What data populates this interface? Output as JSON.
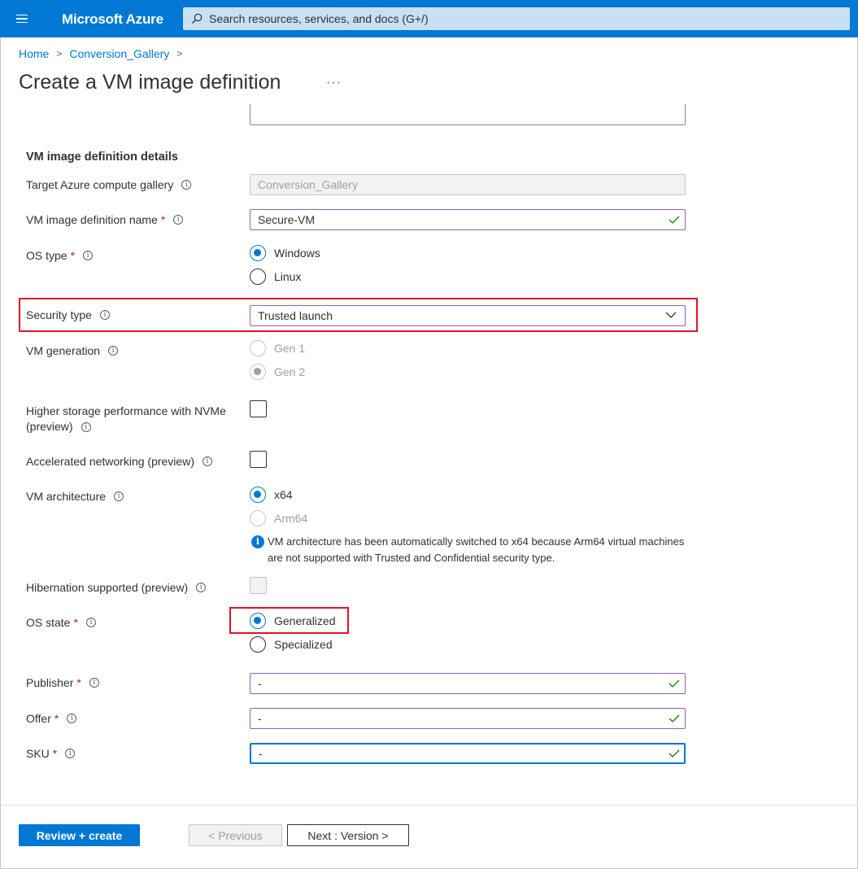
{
  "topbar": {
    "brand": "Microsoft Azure",
    "search_placeholder": "Search resources, services, and docs (G+/)"
  },
  "breadcrumb": {
    "items": [
      "Home",
      "Conversion_Gallery"
    ]
  },
  "page": {
    "title": "Create a VM image definition",
    "more": "···"
  },
  "form": {
    "section_title": "VM image definition details",
    "target_gallery": {
      "label": "Target Azure compute gallery",
      "value": "Conversion_Gallery"
    },
    "definition_name": {
      "label": "VM image definition name",
      "value": "Secure-VM"
    },
    "os_type": {
      "label": "OS type",
      "options": [
        "Windows",
        "Linux"
      ],
      "selected": "Windows"
    },
    "security_type": {
      "label": "Security type",
      "value": "Trusted launch"
    },
    "vm_generation": {
      "label": "VM generation",
      "options": [
        "Gen 1",
        "Gen 2"
      ],
      "selected": "Gen 2"
    },
    "nvme": {
      "label_line1": "Higher storage performance with NVMe",
      "label_line2": "(preview)",
      "checked": false
    },
    "accel_net": {
      "label": "Accelerated networking (preview)",
      "checked": false
    },
    "vm_arch": {
      "label": "VM architecture",
      "options": [
        "x64",
        "Arm64"
      ],
      "selected": "x64",
      "note": "VM architecture has been automatically switched to x64 because Arm64 virtual machines are not supported with Trusted and Confidential security type."
    },
    "hibernation": {
      "label": "Hibernation supported (preview)",
      "checked": false
    },
    "os_state": {
      "label": "OS state",
      "options": [
        "Generalized",
        "Specialized"
      ],
      "selected": "Generalized"
    },
    "publisher": {
      "label": "Publisher",
      "value": "-"
    },
    "offer": {
      "label": "Offer",
      "value": "-"
    },
    "sku": {
      "label": "SKU",
      "value": "-"
    },
    "required_mark": "*",
    "info_glyph": "i"
  },
  "footer": {
    "review_create": "Review + create",
    "previous": "< Previous",
    "next": "Next : Version >"
  },
  "colors": {
    "azure_blue": "#0078d4",
    "highlight_red": "#e81123",
    "valid_green": "#107c10",
    "required_red": "#a4262c"
  }
}
